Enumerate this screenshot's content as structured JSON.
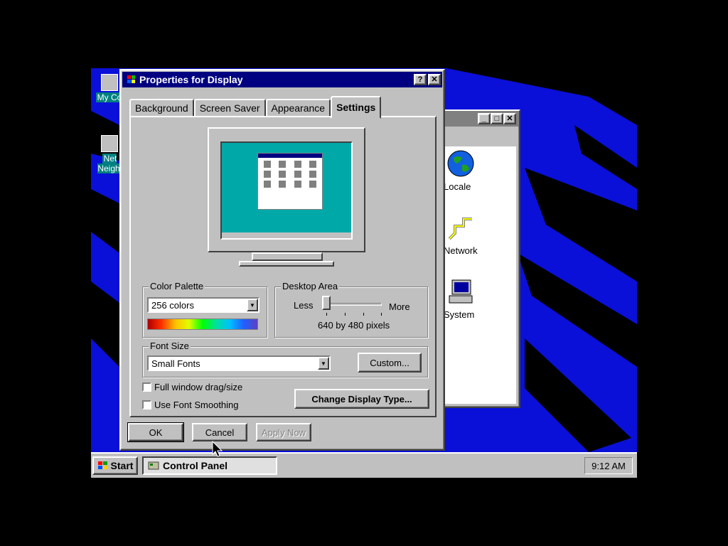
{
  "desktop": {
    "icons": [
      {
        "label": "My Co"
      },
      {
        "label": "Net Neigh"
      }
    ]
  },
  "control_panel": {
    "items": [
      {
        "label": "Locale",
        "icon": "globe-icon"
      },
      {
        "label": "Network",
        "icon": "network-icon"
      },
      {
        "label": "System",
        "icon": "computer-icon"
      }
    ]
  },
  "dialog": {
    "title": "Properties for Display",
    "help_btn": "?",
    "close_btn": "✕",
    "tabs": [
      {
        "label": "Background"
      },
      {
        "label": "Screen Saver"
      },
      {
        "label": "Appearance"
      },
      {
        "label": "Settings",
        "active": true
      }
    ],
    "color_palette": {
      "legend": "Color Palette",
      "value": "256 colors"
    },
    "desktop_area": {
      "legend": "Desktop Area",
      "less": "Less",
      "more": "More",
      "resolution": "640 by 480 pixels",
      "slider_position": 0
    },
    "font_size": {
      "legend": "Font Size",
      "value": "Small Fonts",
      "custom_btn": "Custom..."
    },
    "checkboxes": [
      {
        "label": "Full window drag/size",
        "checked": false
      },
      {
        "label": "Use Font Smoothing",
        "checked": false
      }
    ],
    "change_display_btn": "Change Display Type...",
    "ok_btn": "OK",
    "cancel_btn": "Cancel",
    "apply_btn": "Apply Now"
  },
  "taskbar": {
    "start": "Start",
    "task": "Control Panel",
    "clock": "9:12 AM"
  },
  "colors": {
    "desktop": "#0a10d8",
    "title_active": "#000080",
    "face": "#c0c0c0"
  }
}
